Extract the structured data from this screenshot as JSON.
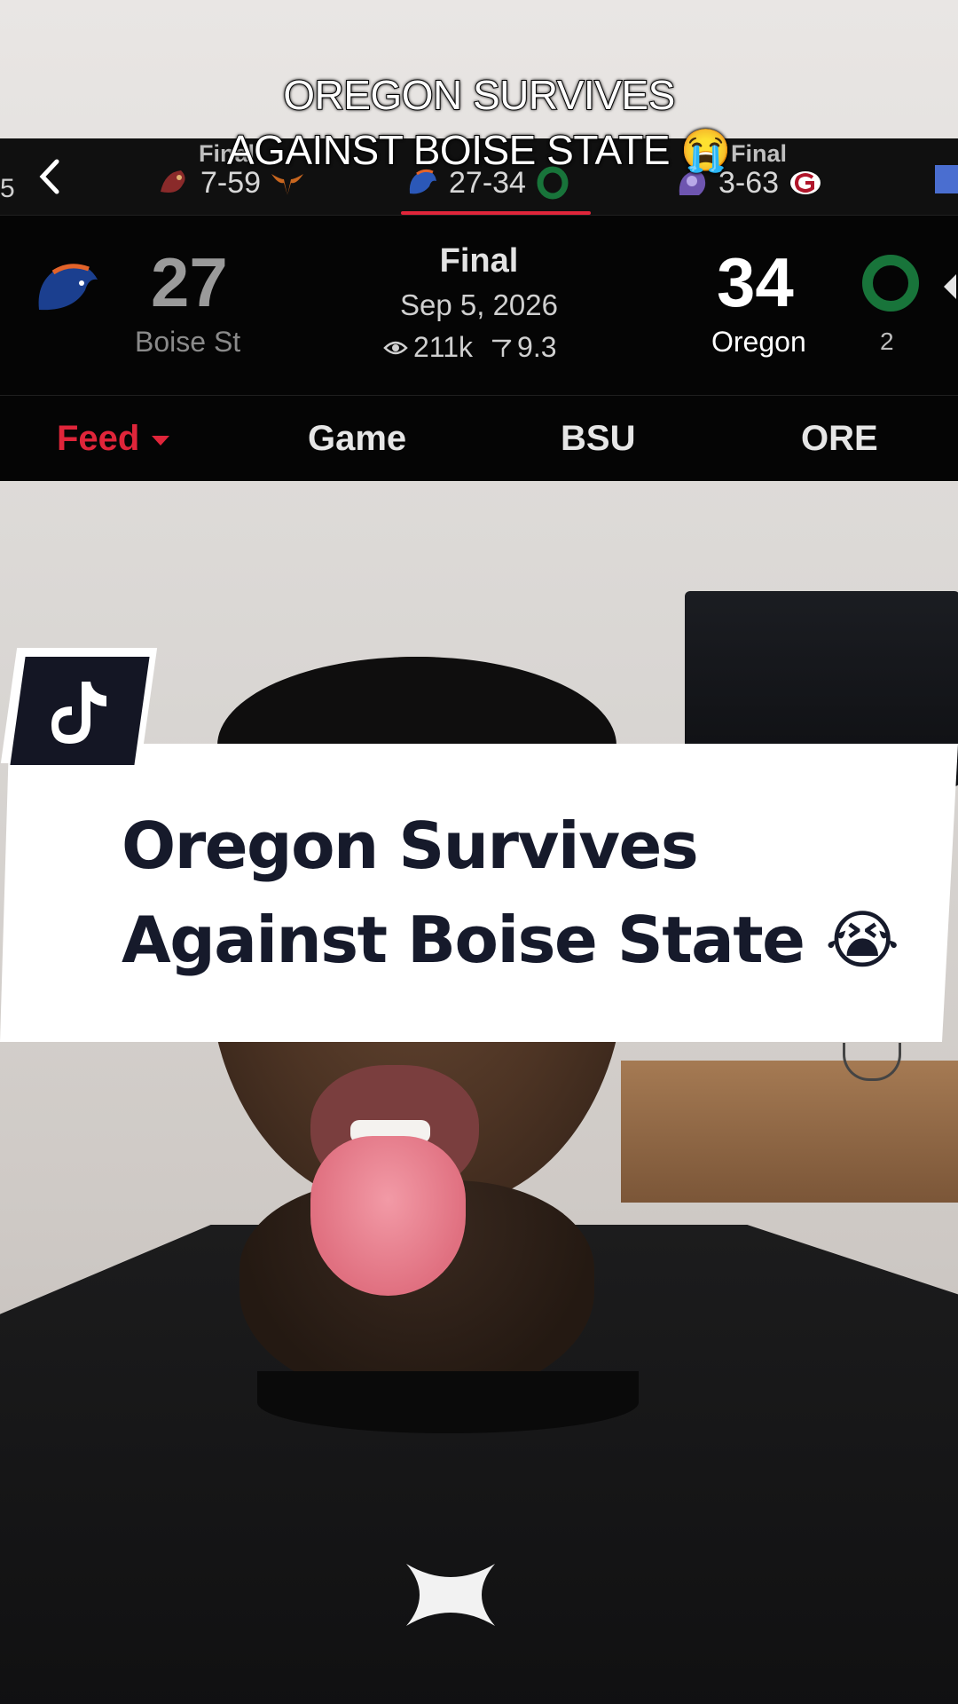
{
  "video_caption": {
    "line1": "OREGON SURVIVES",
    "line2": "AGAINST BOISE STATE 😭"
  },
  "scores_strip": {
    "back_icon": "chevron-left-icon",
    "left_fragment": "5",
    "games": [
      {
        "status": "Final",
        "score": "7-59",
        "icons": [
          "texas-state-bobcat-icon",
          "texas-longhorn-icon"
        ]
      },
      {
        "status": "",
        "score": "27-34",
        "icons": [
          "boise-state-bronco-icon",
          "oregon-o-icon"
        ],
        "active": true
      },
      {
        "status": "Final",
        "score": "3-63",
        "icons": [
          "austin-peay-icon",
          "georgia-g-icon"
        ]
      }
    ],
    "accent_color": "#e0253a"
  },
  "scoreboard": {
    "away": {
      "score": "27",
      "name": "Boise St",
      "logo": "boise-state-bronco-logo"
    },
    "status": "Final",
    "date": "Sep 5, 2026",
    "views": "211k",
    "rating": "9.3",
    "home": {
      "score": "34",
      "name": "Oregon",
      "rank": "2",
      "logo": "oregon-o-logo"
    }
  },
  "tabs": [
    {
      "label": "Feed",
      "active": true
    },
    {
      "label": "Game"
    },
    {
      "label": "BSU"
    },
    {
      "label": "ORE"
    }
  ],
  "overlay_card": {
    "app_icon": "tiktok-icon",
    "title_line1": "Oregon Survives",
    "title_line2": "Against Boise State 😭"
  },
  "colors": {
    "oregon_green": "#18743a",
    "boise_blue": "#1b3f8f",
    "boise_orange": "#e2632a",
    "card_text": "#161a2b"
  }
}
